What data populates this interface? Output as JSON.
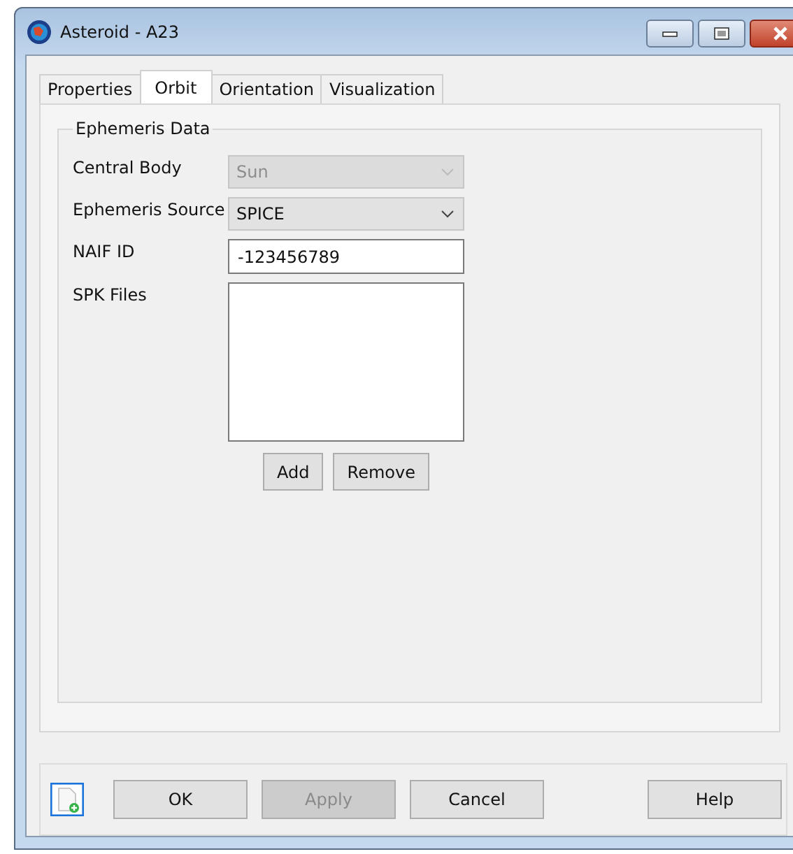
{
  "window": {
    "title": "Asteroid - A23"
  },
  "tabs": [
    {
      "label": "Properties",
      "selected": false
    },
    {
      "label": "Orbit",
      "selected": true
    },
    {
      "label": "Orientation",
      "selected": false
    },
    {
      "label": "Visualization",
      "selected": false
    }
  ],
  "group": {
    "title": "Ephemeris Data",
    "fields": [
      {
        "kind": "dropdown",
        "label": "Central Body",
        "value": "Sun",
        "disabled": true
      },
      {
        "kind": "dropdown",
        "label": "Ephemeris Source",
        "value": "SPICE",
        "disabled": false
      },
      {
        "kind": "text",
        "label": "NAIF ID",
        "value": "-123456789",
        "disabled": false
      },
      {
        "kind": "list",
        "label": "SPK Files",
        "disabled": false
      }
    ],
    "list_buttons": [
      {
        "label": "Add",
        "disabled": false
      },
      {
        "label": "Remove",
        "disabled": false
      }
    ]
  },
  "buttons": [
    {
      "label": "OK",
      "disabled": false
    },
    {
      "label": "Apply",
      "disabled": true
    },
    {
      "label": "Cancel",
      "disabled": false
    },
    {
      "label": "Help",
      "disabled": false
    }
  ]
}
